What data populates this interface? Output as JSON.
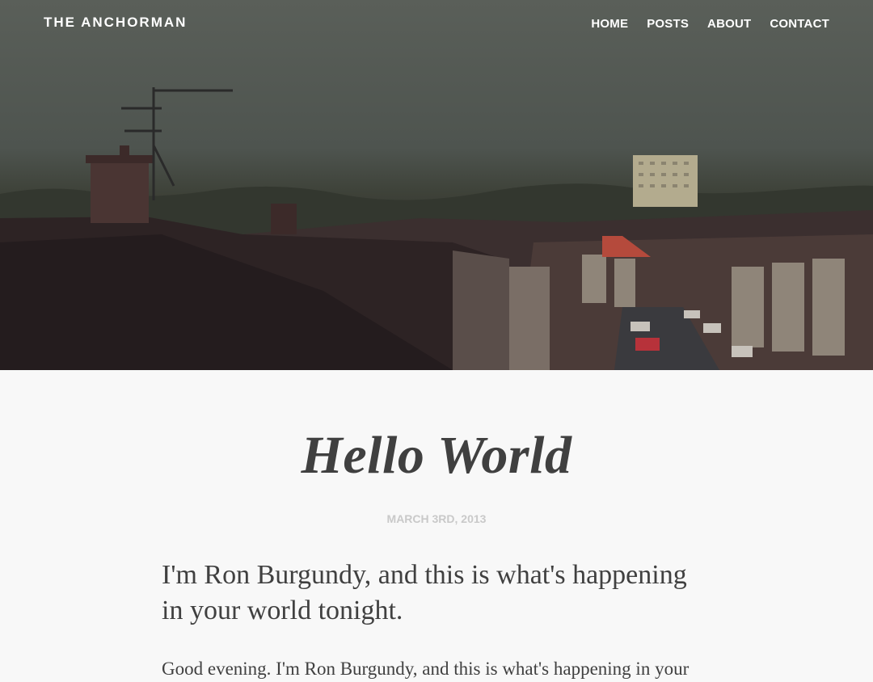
{
  "site": {
    "brand": "THE ANCHORMAN"
  },
  "nav": {
    "items": [
      {
        "label": "HOME"
      },
      {
        "label": "POSTS"
      },
      {
        "label": "ABOUT"
      },
      {
        "label": "CONTACT"
      }
    ]
  },
  "post": {
    "title": "Hello World",
    "date": "MARCH 3RD, 2013",
    "subtitle": "I'm Ron Burgundy, and this is what's happening in your world tonight.",
    "body": "Good evening. I'm Ron Burgundy, and this is what's happening in your"
  },
  "colors": {
    "text": "#404040",
    "date": "#c9c9c9",
    "background": "#f8f8f8",
    "nav_text": "#ffffff"
  }
}
